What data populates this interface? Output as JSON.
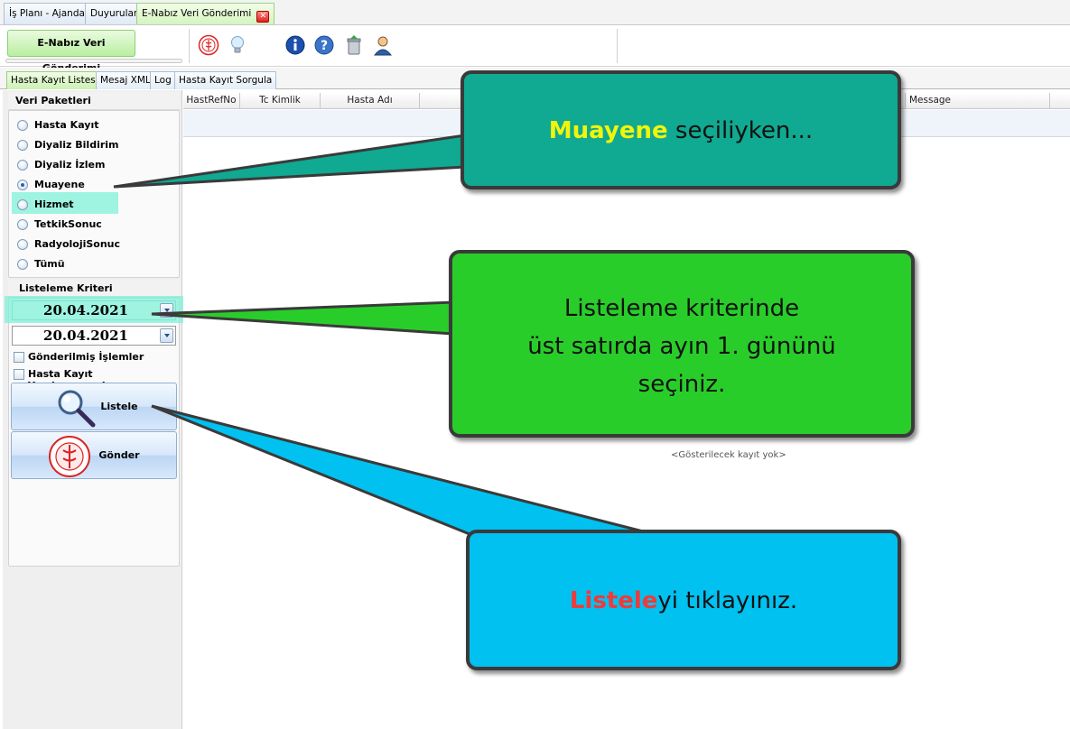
{
  "doc_tabs": [
    {
      "label": "İş Planı - Ajanda"
    },
    {
      "label": "Duyurular"
    },
    {
      "label": "E-Nabız Veri Gönderimi",
      "close": "✕"
    }
  ],
  "ribbon": {
    "group_label": "E-Nabız Veri Gönderimi",
    "icons": [
      "saglik-bakanligi-logo-icon",
      "lightbulb-icon",
      "info-icon",
      "help-icon",
      "recycle-bin-icon",
      "user-icon"
    ]
  },
  "sub_tabs": [
    {
      "label": "Hasta Kayıt Listesi"
    },
    {
      "label": "Mesaj XML"
    },
    {
      "label": "Log"
    },
    {
      "label": "Hasta Kayıt Sorgula"
    }
  ],
  "veri_paketleri": {
    "title": "Veri Paketleri",
    "options": [
      "Hasta Kayıt",
      "Diyaliz Bildirim",
      "Diyaliz İzlem",
      "Muayene",
      "Hizmet",
      "TetkikSonuc",
      "RadyolojiSonuc",
      "Tümü"
    ],
    "selected": "Muayene"
  },
  "criteria": {
    "title": "Listeleme Kriteri",
    "date_start": "20.04.2021",
    "date_end": "20.04.2021",
    "checks": [
      "Gönderilmiş İşlemler",
      "Hasta Kayıt Yapılmammışlar"
    ],
    "listele_label": "Listele",
    "gonder_label": "Gönder"
  },
  "grid": {
    "columns": [
      "HastRefNo",
      "Tc Kimlik",
      "Hasta Adı",
      "Message"
    ],
    "empty_text": "<Gösterilecek kayıt yok>"
  },
  "callouts": {
    "c1": {
      "highlight": "Muayene",
      "text": " seçiliyken..."
    },
    "c2": {
      "lines": [
        "Listeleme kriterinde",
        "üst satırda ayın 1. gününü",
        "seçiniz."
      ]
    },
    "c3": {
      "highlight": "Listele",
      "text": "yi tıklayınız."
    }
  },
  "colors": {
    "callout1": "#10a991",
    "callout2": "#29cd2a",
    "callout3": "#00c1f0",
    "highlight": "#7ff0d8"
  }
}
